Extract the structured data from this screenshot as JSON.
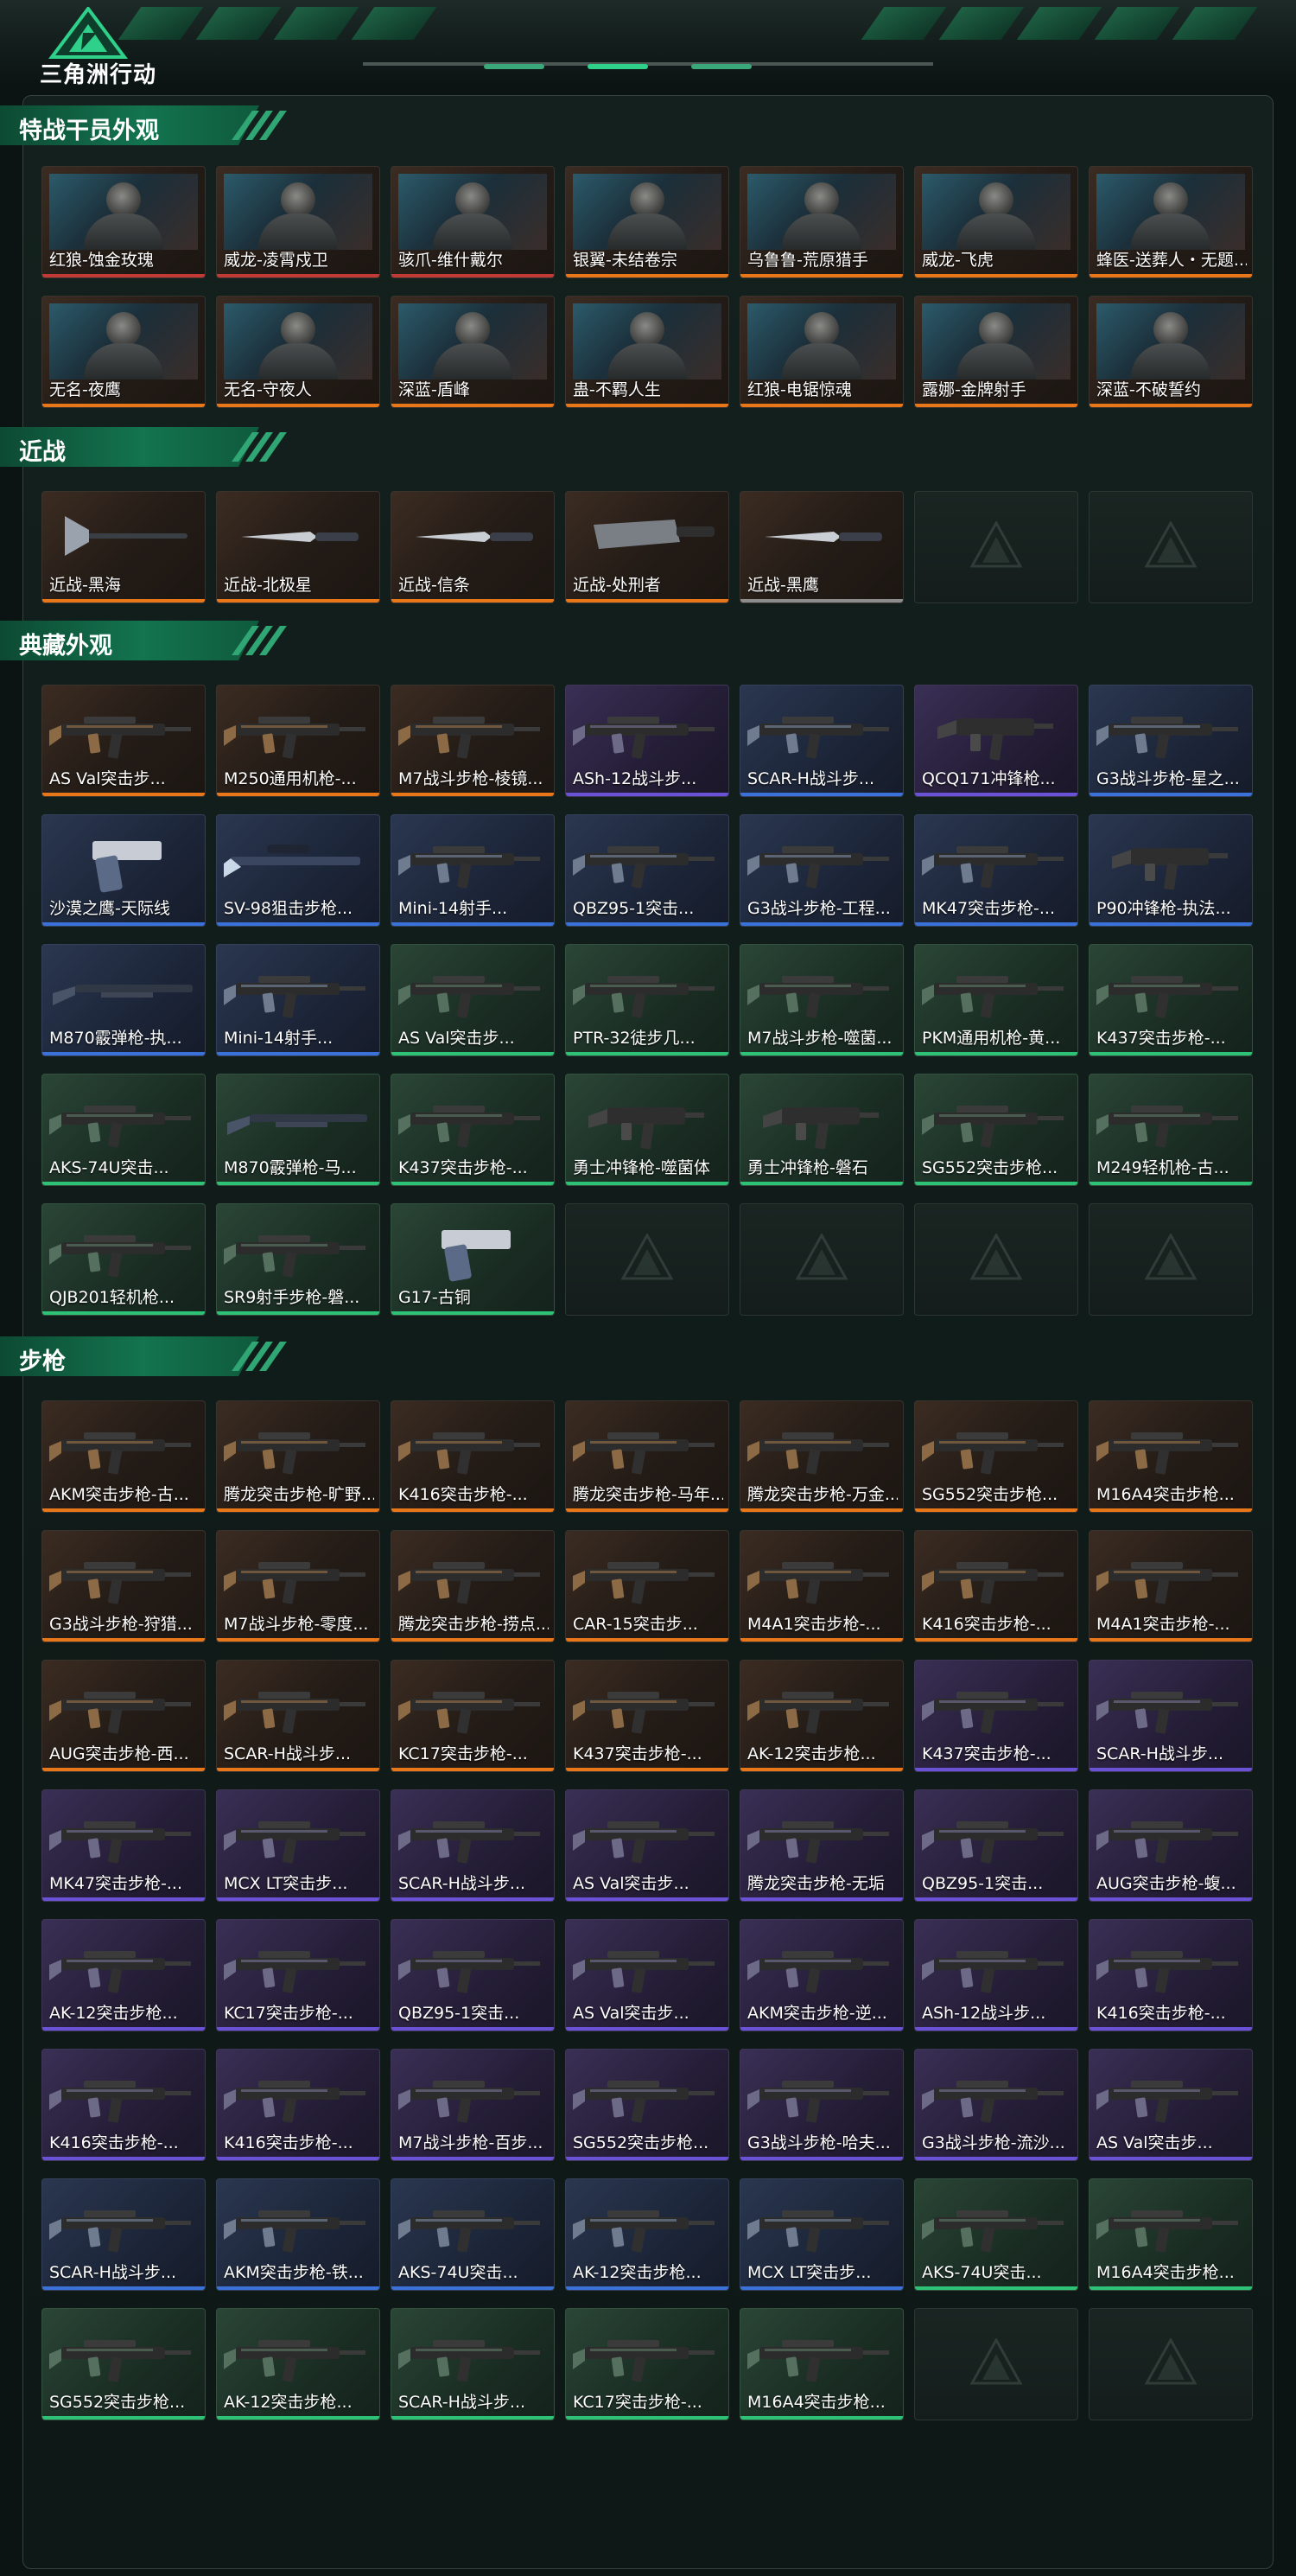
{
  "app": {
    "title": "三角洲行动"
  },
  "colors": {
    "accent": "#2fa673",
    "rarity_orange": "#e8771a",
    "rarity_red": "#c23a36",
    "rarity_purple": "#6a52d6",
    "rarity_blue": "#3b72d9",
    "rarity_green": "#2ec276",
    "rarity_gray": "#8c8c8c"
  },
  "sections": [
    {
      "title": "特战干员外观",
      "items": [
        {
          "label": "红狼-蚀金玫瑰",
          "rarity": "red",
          "icon": "operator-portrait"
        },
        {
          "label": "威龙-凌霄戍卫",
          "rarity": "red",
          "icon": "operator-portrait"
        },
        {
          "label": "骇爪-维什戴尔",
          "rarity": "red",
          "icon": "operator-portrait"
        },
        {
          "label": "银翼-未结卷宗",
          "rarity": "orange",
          "icon": "operator-portrait"
        },
        {
          "label": "乌鲁鲁-荒原猎手",
          "rarity": "orange",
          "icon": "operator-portrait"
        },
        {
          "label": "威龙-飞虎",
          "rarity": "orange",
          "icon": "operator-portrait"
        },
        {
          "label": "蜂医-送葬人・无题...",
          "rarity": "orange",
          "icon": "operator-portrait"
        },
        {
          "label": "无名-夜鹰",
          "rarity": "orange",
          "icon": "operator-portrait"
        },
        {
          "label": "无名-守夜人",
          "rarity": "orange",
          "icon": "operator-portrait"
        },
        {
          "label": "深蓝-盾峰",
          "rarity": "orange",
          "icon": "operator-portrait"
        },
        {
          "label": "蛊-不羁人生",
          "rarity": "orange",
          "icon": "operator-portrait"
        },
        {
          "label": "红狼-电锯惊魂",
          "rarity": "orange",
          "icon": "operator-portrait"
        },
        {
          "label": "露娜-金牌射手",
          "rarity": "orange",
          "icon": "operator-portrait"
        },
        {
          "label": "深蓝-不破誓约",
          "rarity": "orange",
          "icon": "operator-portrait"
        }
      ]
    },
    {
      "title": "近战",
      "items": [
        {
          "label": "近战-黑海",
          "rarity": "orange",
          "icon": "melee-axe"
        },
        {
          "label": "近战-北极星",
          "rarity": "orange",
          "icon": "melee-knife"
        },
        {
          "label": "近战-信条",
          "rarity": "orange",
          "icon": "melee-knife"
        },
        {
          "label": "近战-处刑者",
          "rarity": "orange",
          "icon": "melee-cleaver"
        },
        {
          "label": "近战-黑鹰",
          "rarity": "gray",
          "icon": "melee-knife"
        },
        {
          "empty": true
        },
        {
          "empty": true
        }
      ]
    },
    {
      "title": "典藏外观",
      "items": [
        {
          "label": "AS Val突击步...",
          "rarity": "orange",
          "icon": "rifle"
        },
        {
          "label": "M250通用机枪-...",
          "rarity": "orange",
          "icon": "rifle"
        },
        {
          "label": "M7战斗步枪-棱镜...",
          "rarity": "orange",
          "icon": "rifle"
        },
        {
          "label": "ASh-12战斗步...",
          "rarity": "purple",
          "icon": "rifle"
        },
        {
          "label": "SCAR-H战斗步...",
          "rarity": "blue",
          "icon": "rifle"
        },
        {
          "label": "QCQ171冲锋枪...",
          "rarity": "purple",
          "icon": "smg"
        },
        {
          "label": "G3战斗步枪-星之...",
          "rarity": "blue",
          "icon": "rifle"
        },
        {
          "label": "沙漠之鹰-天际线",
          "rarity": "blue",
          "icon": "pistol"
        },
        {
          "label": "SV-98狙击步枪...",
          "rarity": "blue",
          "icon": "sniper"
        },
        {
          "label": "Mini-14射手...",
          "rarity": "blue",
          "icon": "rifle"
        },
        {
          "label": "QBZ95-1突击...",
          "rarity": "blue",
          "icon": "rifle"
        },
        {
          "label": "G3战斗步枪-工程...",
          "rarity": "blue",
          "icon": "rifle"
        },
        {
          "label": "MK47突击步枪-...",
          "rarity": "blue",
          "icon": "rifle"
        },
        {
          "label": "P90冲锋枪-执法...",
          "rarity": "blue",
          "icon": "smg"
        },
        {
          "label": "M870霰弹枪-执...",
          "rarity": "blue",
          "icon": "shotgun"
        },
        {
          "label": "Mini-14射手...",
          "rarity": "blue",
          "icon": "rifle"
        },
        {
          "label": "AS Val突击步...",
          "rarity": "green",
          "icon": "rifle"
        },
        {
          "label": "PTR-32徒步几...",
          "rarity": "green",
          "icon": "rifle"
        },
        {
          "label": "M7战斗步枪-噬菌...",
          "rarity": "green",
          "icon": "rifle"
        },
        {
          "label": "PKM通用机枪-黄...",
          "rarity": "green",
          "icon": "rifle"
        },
        {
          "label": "K437突击步枪-...",
          "rarity": "green",
          "icon": "rifle"
        },
        {
          "label": "AKS-74U突击...",
          "rarity": "green",
          "icon": "rifle"
        },
        {
          "label": "M870霰弹枪-马...",
          "rarity": "green",
          "icon": "shotgun"
        },
        {
          "label": "K437突击步枪-...",
          "rarity": "green",
          "icon": "rifle"
        },
        {
          "label": "勇士冲锋枪-噬菌体",
          "rarity": "green",
          "icon": "smg"
        },
        {
          "label": "勇士冲锋枪-磐石",
          "rarity": "green",
          "icon": "smg"
        },
        {
          "label": "SG552突击步枪...",
          "rarity": "green",
          "icon": "rifle"
        },
        {
          "label": "M249轻机枪-古...",
          "rarity": "green",
          "icon": "rifle"
        },
        {
          "label": "QJB201轻机枪...",
          "rarity": "green",
          "icon": "rifle"
        },
        {
          "label": "SR9射手步枪-磐...",
          "rarity": "green",
          "icon": "rifle"
        },
        {
          "label": "G17-古铜",
          "rarity": "green",
          "icon": "pistol"
        },
        {
          "empty": true
        },
        {
          "empty": true
        },
        {
          "empty": true
        },
        {
          "empty": true
        }
      ]
    },
    {
      "title": "步枪",
      "items": [
        {
          "label": "AKM突击步枪-古...",
          "rarity": "orange",
          "icon": "rifle"
        },
        {
          "label": "腾龙突击步枪-旷野...",
          "rarity": "orange",
          "icon": "rifle"
        },
        {
          "label": "K416突击步枪-...",
          "rarity": "orange",
          "icon": "rifle"
        },
        {
          "label": "腾龙突击步枪-马年...",
          "rarity": "orange",
          "icon": "rifle"
        },
        {
          "label": "腾龙突击步枪-万金...",
          "rarity": "orange",
          "icon": "rifle"
        },
        {
          "label": "SG552突击步枪...",
          "rarity": "orange",
          "icon": "rifle"
        },
        {
          "label": "M16A4突击步枪...",
          "rarity": "orange",
          "icon": "rifle"
        },
        {
          "label": "G3战斗步枪-狩猎...",
          "rarity": "orange",
          "icon": "rifle"
        },
        {
          "label": "M7战斗步枪-零度...",
          "rarity": "orange",
          "icon": "rifle"
        },
        {
          "label": "腾龙突击步枪-捞点...",
          "rarity": "orange",
          "icon": "rifle"
        },
        {
          "label": "CAR-15突击步...",
          "rarity": "orange",
          "icon": "rifle"
        },
        {
          "label": "M4A1突击步枪-...",
          "rarity": "orange",
          "icon": "rifle"
        },
        {
          "label": "K416突击步枪-...",
          "rarity": "orange",
          "icon": "rifle"
        },
        {
          "label": "M4A1突击步枪-...",
          "rarity": "orange",
          "icon": "rifle"
        },
        {
          "label": "AUG突击步枪-西...",
          "rarity": "orange",
          "icon": "rifle"
        },
        {
          "label": "SCAR-H战斗步...",
          "rarity": "orange",
          "icon": "rifle"
        },
        {
          "label": "KC17突击步枪-...",
          "rarity": "orange",
          "icon": "rifle"
        },
        {
          "label": "K437突击步枪-...",
          "rarity": "orange",
          "icon": "rifle"
        },
        {
          "label": "AK-12突击步枪...",
          "rarity": "orange",
          "icon": "rifle"
        },
        {
          "label": "K437突击步枪-...",
          "rarity": "purple",
          "icon": "rifle"
        },
        {
          "label": "SCAR-H战斗步...",
          "rarity": "purple",
          "icon": "rifle"
        },
        {
          "label": "MK47突击步枪-...",
          "rarity": "purple",
          "icon": "rifle"
        },
        {
          "label": "MCX LT突击步...",
          "rarity": "purple",
          "icon": "rifle"
        },
        {
          "label": "SCAR-H战斗步...",
          "rarity": "purple",
          "icon": "rifle"
        },
        {
          "label": "AS Val突击步...",
          "rarity": "purple",
          "icon": "rifle"
        },
        {
          "label": "腾龙突击步枪-无垢",
          "rarity": "purple",
          "icon": "rifle"
        },
        {
          "label": "QBZ95-1突击...",
          "rarity": "purple",
          "icon": "rifle"
        },
        {
          "label": "AUG突击步枪-蝮...",
          "rarity": "purple",
          "icon": "rifle"
        },
        {
          "label": "AK-12突击步枪...",
          "rarity": "purple",
          "icon": "rifle"
        },
        {
          "label": "KC17突击步枪-...",
          "rarity": "purple",
          "icon": "rifle"
        },
        {
          "label": "QBZ95-1突击...",
          "rarity": "purple",
          "icon": "rifle"
        },
        {
          "label": "AS Val突击步...",
          "rarity": "purple",
          "icon": "rifle"
        },
        {
          "label": "AKM突击步枪-逆...",
          "rarity": "purple",
          "icon": "rifle"
        },
        {
          "label": "ASh-12战斗步...",
          "rarity": "purple",
          "icon": "rifle"
        },
        {
          "label": "K416突击步枪-...",
          "rarity": "purple",
          "icon": "rifle"
        },
        {
          "label": "K416突击步枪-...",
          "rarity": "purple",
          "icon": "rifle"
        },
        {
          "label": "K416突击步枪-...",
          "rarity": "purple",
          "icon": "rifle"
        },
        {
          "label": "M7战斗步枪-百步...",
          "rarity": "purple",
          "icon": "rifle"
        },
        {
          "label": "SG552突击步枪...",
          "rarity": "purple",
          "icon": "rifle"
        },
        {
          "label": "G3战斗步枪-哈夫...",
          "rarity": "purple",
          "icon": "rifle"
        },
        {
          "label": "G3战斗步枪-流沙...",
          "rarity": "purple",
          "icon": "rifle"
        },
        {
          "label": "AS Val突击步...",
          "rarity": "purple",
          "icon": "rifle"
        },
        {
          "label": "SCAR-H战斗步...",
          "rarity": "blue",
          "icon": "rifle"
        },
        {
          "label": "AKM突击步枪-铁...",
          "rarity": "blue",
          "icon": "rifle"
        },
        {
          "label": "AKS-74U突击...",
          "rarity": "blue",
          "icon": "rifle"
        },
        {
          "label": "AK-12突击步枪...",
          "rarity": "blue",
          "icon": "rifle"
        },
        {
          "label": "MCX LT突击步...",
          "rarity": "blue",
          "icon": "rifle"
        },
        {
          "label": "AKS-74U突击...",
          "rarity": "green",
          "icon": "rifle"
        },
        {
          "label": "M16A4突击步枪...",
          "rarity": "green",
          "icon": "rifle"
        },
        {
          "label": "SG552突击步枪...",
          "rarity": "green",
          "icon": "rifle"
        },
        {
          "label": "AK-12突击步枪...",
          "rarity": "green",
          "icon": "rifle"
        },
        {
          "label": "SCAR-H战斗步...",
          "rarity": "green",
          "icon": "rifle"
        },
        {
          "label": "KC17突击步枪-...",
          "rarity": "green",
          "icon": "rifle"
        },
        {
          "label": "M16A4突击步枪...",
          "rarity": "green",
          "icon": "rifle"
        },
        {
          "empty": true
        },
        {
          "empty": true
        }
      ]
    }
  ]
}
